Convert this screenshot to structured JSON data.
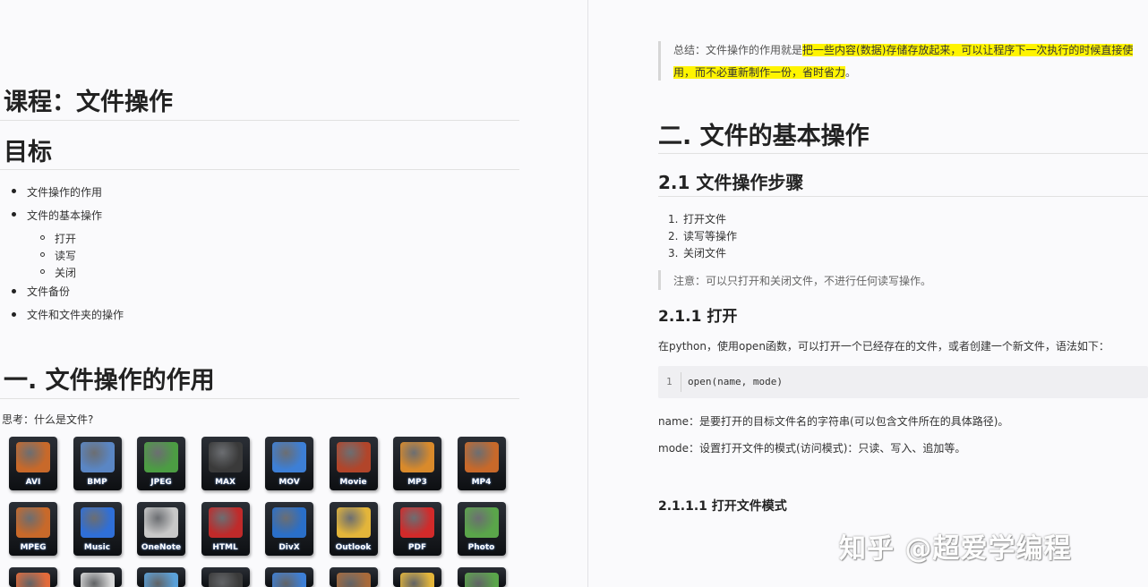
{
  "left_page": {
    "course_title": "课程：文件操作",
    "goal_title": "目标",
    "goal_items": [
      "文件操作的作用",
      "文件的基本操作",
      "文件备份",
      "文件和文件夹的操作"
    ],
    "goal_subitems": [
      "打开",
      "读写",
      "关闭"
    ],
    "section1_title": "一. 文件操作的作用",
    "think_text": "思考：什么是文件?",
    "icons": [
      {
        "label": "AVI",
        "icon": "film-reel-icon",
        "color": "#c8692a"
      },
      {
        "label": "BMP",
        "icon": "picture-icon",
        "color": "#5a86c4"
      },
      {
        "label": "JPEG",
        "icon": "landscape-icon",
        "color": "#4c9d43"
      },
      {
        "label": "MAX",
        "icon": "3ds-max-icon",
        "color": "#3a3a3a"
      },
      {
        "label": "MOV",
        "icon": "quicktime-icon",
        "color": "#3d7fd6"
      },
      {
        "label": "Movie",
        "icon": "movie-icon",
        "color": "#b2452a"
      },
      {
        "label": "MP3",
        "icon": "audio-icon",
        "color": "#d98a2b"
      },
      {
        "label": "MP4",
        "icon": "video-icon",
        "color": "#c8692a"
      },
      {
        "label": "MPEG",
        "icon": "film-reel-icon",
        "color": "#c8692a"
      },
      {
        "label": "Music",
        "icon": "play-icon",
        "color": "#2f6fd8"
      },
      {
        "label": "OneNote",
        "icon": "notebook-icon",
        "color": "#c8c8c8"
      },
      {
        "label": "HTML",
        "icon": "opera-icon",
        "color": "#c02a2a"
      },
      {
        "label": "DivX",
        "icon": "divx-icon",
        "color": "#2a6fc9"
      },
      {
        "label": "Outlook",
        "icon": "mail-icon",
        "color": "#e3b53a"
      },
      {
        "label": "PDF",
        "icon": "pdf-icon",
        "color": "#d22a2a"
      },
      {
        "label": "Photo",
        "icon": "photo-icon",
        "color": "#5aa54a"
      }
    ],
    "partial_icon_colors": [
      "#e26a3a",
      "#d8d8d8",
      "#5aa0d8",
      "#3a3a3a",
      "#3d7fd6",
      "#a86a3a",
      "#e3b53a",
      "#5aa54a"
    ]
  },
  "right_page": {
    "summary_prefix": "总结：文件操作的作用就是",
    "summary_highlight_1": "把一些内容(数据)存储存放起来，可以让程序下一次执行的时候直接使",
    "summary_highlight_2": "用，而不必重新制作一份，省时省力",
    "summary_end": "。",
    "section2_title": "二. 文件的基本操作",
    "s21_title": "2.1 文件操作步骤",
    "steps": [
      "打开文件",
      "读写等操作",
      "关闭文件"
    ],
    "note": "注意：可以只打开和关闭文件，不进行任何读写操作。",
    "s211_title": "2.1.1 打开",
    "para1": "在python，使用open函数，可以打开一个已经存在的文件，或者创建一个新文件，语法如下：",
    "code_line_number": "1",
    "code_text": "open(name, mode)",
    "param_name": "name：是要打开的目标文件名的字符串(可以包含文件所在的具体路径)。",
    "param_mode": "mode：设置打开文件的模式(访问模式)：只读、写入、追加等。",
    "s2111_title": "2.1.1.1 打开文件模式",
    "watermark": "知乎 @超爱学编程"
  }
}
